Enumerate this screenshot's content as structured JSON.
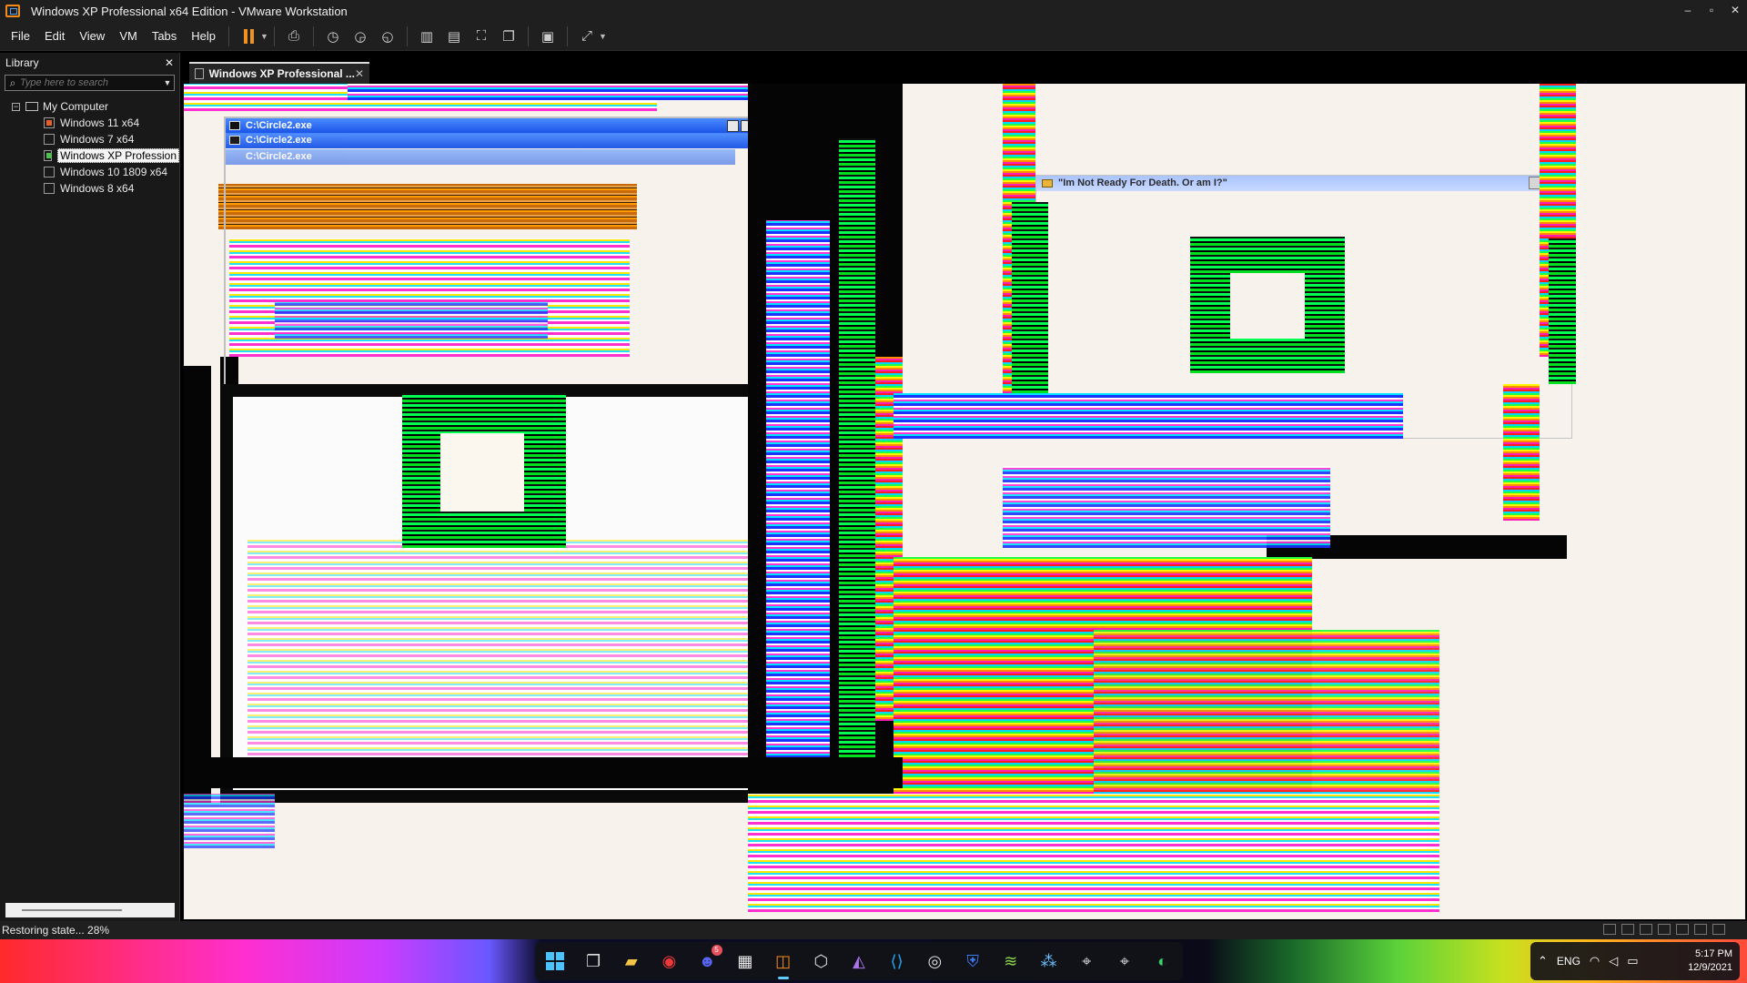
{
  "window": {
    "title": "Windows XP Professional x64 Edition - VMware Workstation",
    "controls": {
      "minimize": "–",
      "maximize": "▫",
      "close": "✕"
    }
  },
  "menu": {
    "file": "File",
    "edit": "Edit",
    "view": "View",
    "vm": "VM",
    "tabs": "Tabs",
    "help": "Help"
  },
  "toolbar": {
    "icons": [
      "pause-icon",
      "send-ctrl-alt-del-icon",
      "snapshot-icon",
      "revert-snapshot-icon",
      "snapshot-manager-icon",
      "show-library-icon",
      "thumbnail-bar-icon",
      "full-screen-icon",
      "unity-icon",
      "console-view-icon",
      "stretch-guest-icon"
    ],
    "accent": "#f0911d"
  },
  "library": {
    "title": "Library",
    "close": "✕",
    "search_placeholder": "Type here to search",
    "root": "My Computer",
    "items": [
      {
        "label": "Windows 11 x64",
        "state": "running"
      },
      {
        "label": "Windows 7 x64",
        "state": "off"
      },
      {
        "label": "Windows XP Profession",
        "state": "active"
      },
      {
        "label": "Windows 10 1809 x64",
        "state": "off"
      },
      {
        "label": "Windows 8 x64",
        "state": "off"
      }
    ]
  },
  "tab": {
    "label": "Windows XP Professional ...",
    "close": "✕"
  },
  "guest": {
    "window1_title": "C:\\Circle2.exe",
    "window1_title_dup": "C:\\Circle2.exe",
    "window1_title_ghost": "C:\\Circle2.exe",
    "message_title": "\"Im Not Ready For Death. Or am I?\""
  },
  "status": {
    "text": "Restoring state... 28%",
    "progress_percent": 28
  },
  "taskbar": {
    "discord_badge": "5",
    "language": "ENG",
    "time": "5:17 PM",
    "date": "12/9/2021",
    "accent": "#60cdff"
  }
}
